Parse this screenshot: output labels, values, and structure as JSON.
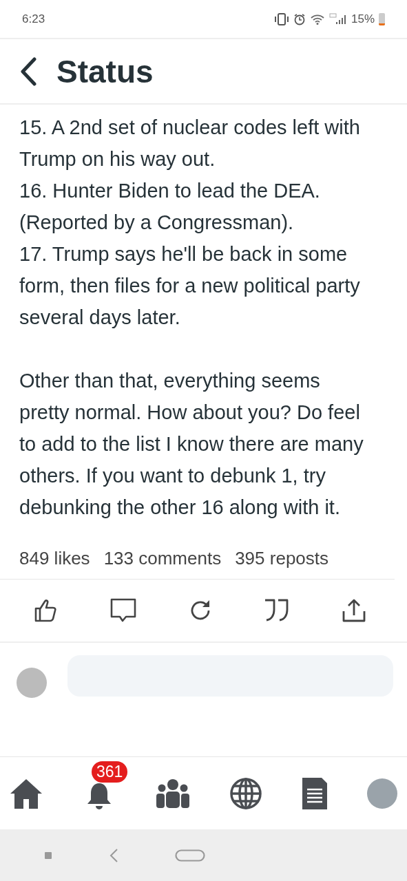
{
  "status_bar": {
    "time": "6:23",
    "battery_text": "15%",
    "battery": {
      "level": 0.15
    }
  },
  "header": {
    "title": "Status"
  },
  "post": {
    "items": [
      "15. A 2nd set of nuclear codes left with Trump on his way out.",
      "16. Hunter Biden to lead the DEA. (Reported by a Congressman).",
      "17. Trump says he'll be back in some form, then files for a new political party several days later."
    ],
    "closing": "Other than that, everything seems pretty normal. How about you? Do feel to add to the list I know there are many others. If you want to debunk 1, try debunking the other 16 along with it."
  },
  "stats": [
    "849 likes",
    "133 comments",
    "395 reposts"
  ],
  "bottom_nav": {
    "notifications_badge": "361"
  }
}
